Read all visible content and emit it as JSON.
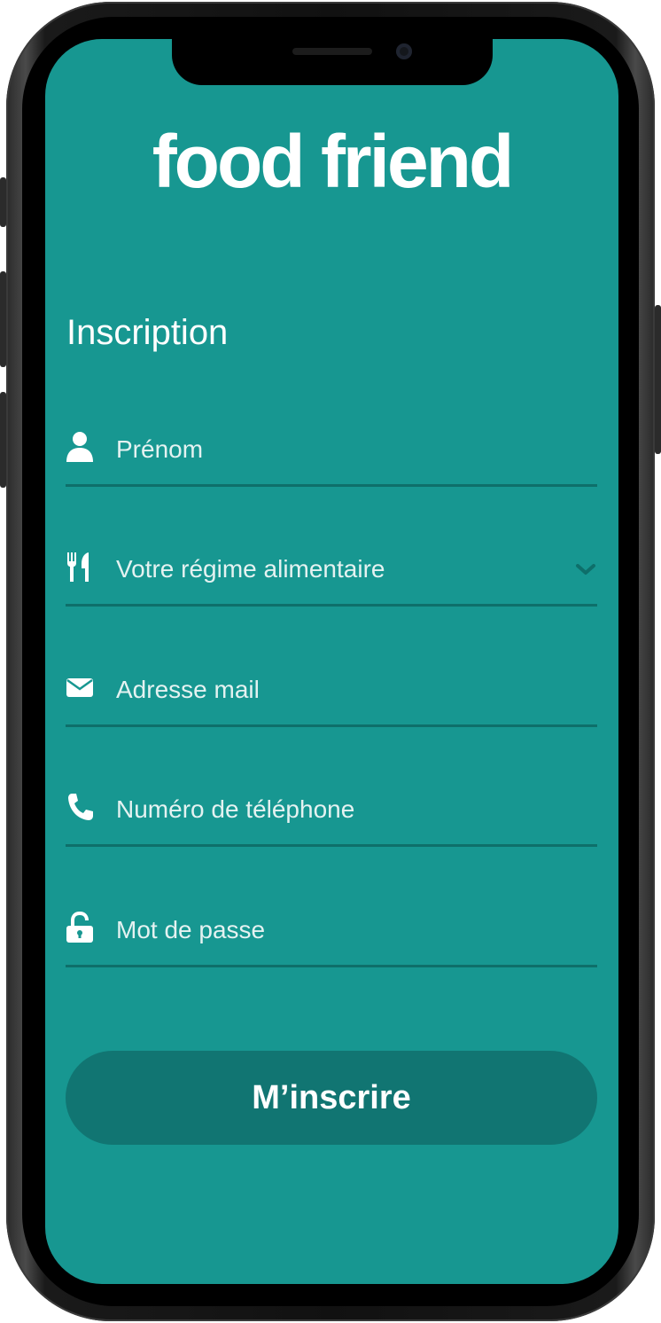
{
  "app": {
    "logo": "food friend"
  },
  "form": {
    "title": "Inscription",
    "fields": [
      {
        "name": "firstname",
        "placeholder": "Prénom",
        "icon": "user-icon"
      },
      {
        "name": "diet",
        "placeholder": "Votre régime alimentaire",
        "icon": "utensils-icon",
        "dropdown": true
      },
      {
        "name": "email",
        "placeholder": "Adresse mail",
        "icon": "envelope-icon"
      },
      {
        "name": "phone",
        "placeholder": "Numéro de téléphone",
        "icon": "phone-icon"
      },
      {
        "name": "password",
        "placeholder": "Mot de passe",
        "icon": "unlock-icon"
      }
    ],
    "submit_label": "M’inscrire"
  },
  "colors": {
    "screen_background": "#179791",
    "underline": "#0e6f6a",
    "button_background": "#117572",
    "text": "#ffffff"
  }
}
